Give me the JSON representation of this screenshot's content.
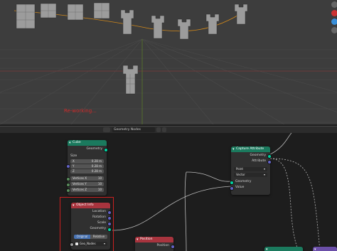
{
  "viewport": {
    "status_text": "Re-working..."
  },
  "editor_header": {
    "tree_name": "Geometry Nodes"
  },
  "nodes": {
    "cube": {
      "title": "Cube",
      "output_geometry": "Geometry",
      "size_label": "Size",
      "size_x_label": "X",
      "size_x_value": "0.28 m",
      "size_y_label": "Y",
      "size_y_value": "0.28 m",
      "size_z_label": "Z",
      "size_z_value": "0.28 m",
      "vertices_x_label": "Vertices X",
      "vertices_x_value": "10",
      "vertices_y_label": "Vertices Y",
      "vertices_y_value": "10",
      "vertices_z_label": "Vertices Z",
      "vertices_z_value": "10"
    },
    "object_info": {
      "title": "Object Info",
      "location": "Location",
      "rotation": "Rotation",
      "scale": "Scale",
      "geometry": "Geometry",
      "original": "Original",
      "relative": "Relative",
      "object_name": "Geo_Nodes"
    },
    "capture_attribute": {
      "title": "Capture Attribute",
      "out_geometry": "Geometry",
      "out_attribute": "Attribute",
      "domain": "Point",
      "data_type": "Vector",
      "in_geometry": "Geometry",
      "in_value": "Value"
    },
    "position": {
      "title": "Position",
      "output": "Position"
    }
  },
  "colors": {
    "geometry_header": "#1b7a5e",
    "input_header": "#a8343e",
    "socket_geometry": "#00d6a3",
    "socket_vector": "#6363c7",
    "highlight": "#cc2020",
    "status_text": "#d22b2b"
  }
}
